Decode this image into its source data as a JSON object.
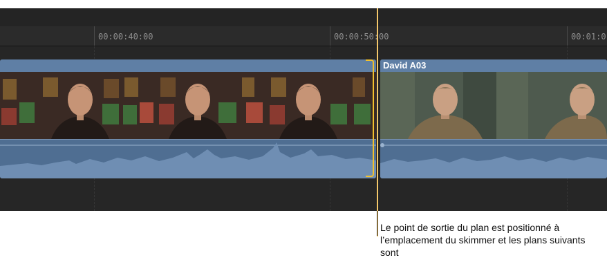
{
  "ruler": {
    "timecodes": [
      "00:00:40:00",
      "00:00:50:00",
      "00:01:0"
    ]
  },
  "clips": [
    {
      "name": "",
      "subject": "presenter-dark-jacket"
    },
    {
      "name": "David A03",
      "subject": "presenter-green-jacket"
    }
  ],
  "callout": {
    "text": "Le point de sortie du plan est positionné à l’emplacement du skimmer et les plans suivants sont"
  },
  "colors": {
    "clip": "#5b7ba1",
    "audio": "#4f6e92",
    "selection": "#f2c12e",
    "playhead": "#f4c76a",
    "timeline_bg": "#1f1f1f"
  }
}
